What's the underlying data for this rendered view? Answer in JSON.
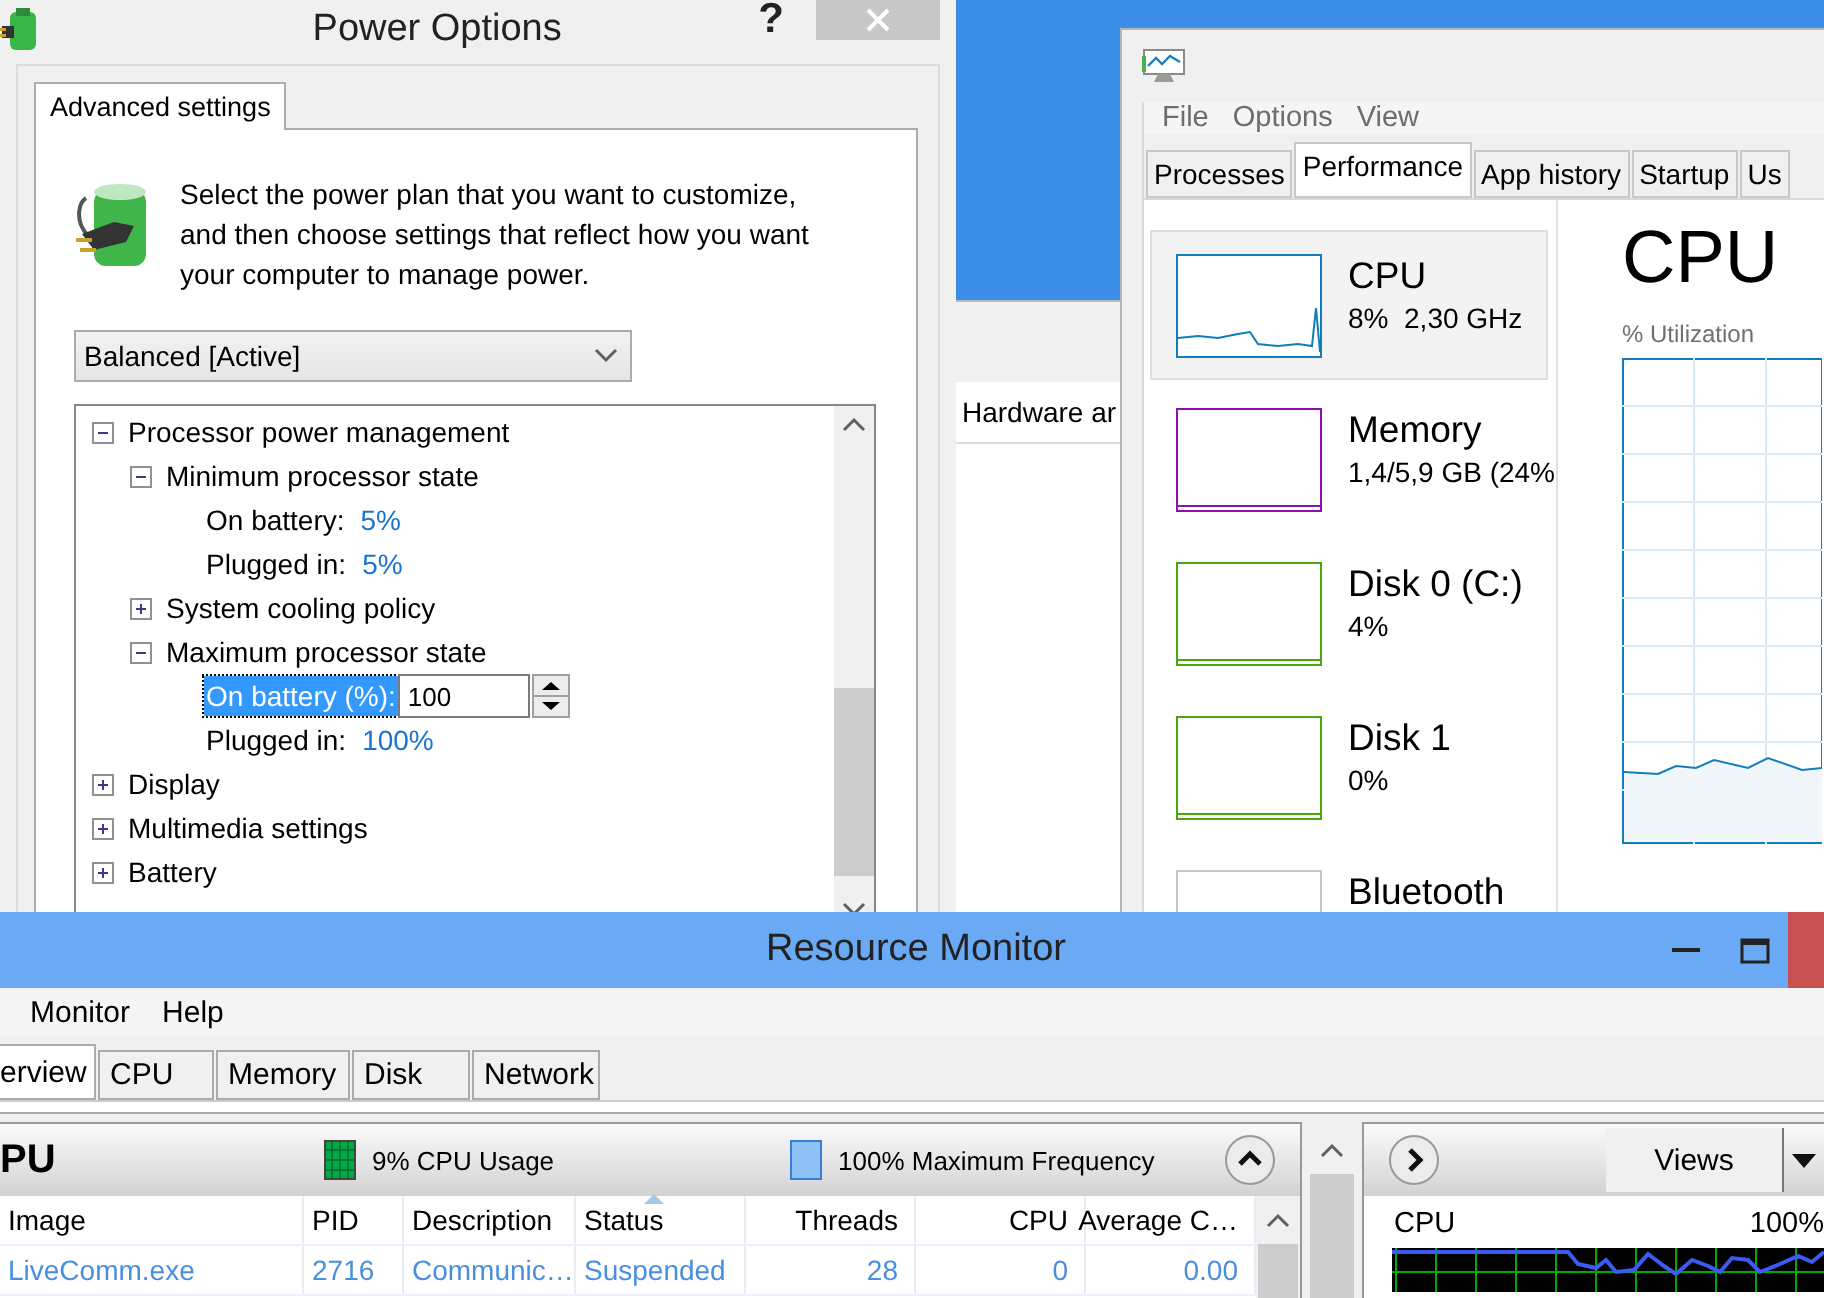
{
  "power_options": {
    "title": "Power Options",
    "help": "?",
    "tab": "Advanced settings",
    "description": "Select the power plan that you want to customize, and then choose settings that reflect how you want your computer to manage power.",
    "plan": "Balanced [Active]",
    "tree": [
      {
        "kind": "group",
        "label": "Processor power management",
        "expanded": true,
        "children": [
          {
            "kind": "group",
            "label": "Minimum processor state",
            "expanded": true,
            "children": [
              {
                "kind": "setting",
                "label": "On battery:",
                "value": "5%",
                "selected": false
              },
              {
                "kind": "setting",
                "label": "Plugged in:",
                "value": "5%",
                "selected": false
              }
            ]
          },
          {
            "kind": "group",
            "label": "System cooling policy",
            "expanded": false
          },
          {
            "kind": "group",
            "label": "Maximum processor state",
            "expanded": true,
            "children": [
              {
                "kind": "edit",
                "label": "On battery (%):",
                "value": "100",
                "selected": true
              },
              {
                "kind": "setting",
                "label": "Plugged in:",
                "value": "100%",
                "selected": false
              }
            ]
          }
        ]
      },
      {
        "kind": "group",
        "label": "Display",
        "expanded": false
      },
      {
        "kind": "group",
        "label": "Multimedia settings",
        "expanded": false
      },
      {
        "kind": "group",
        "label": "Battery",
        "expanded": false
      }
    ]
  },
  "background_window": {
    "row": "Hardware ar"
  },
  "task_manager": {
    "menu": [
      "File",
      "Options",
      "View"
    ],
    "tabs": [
      {
        "label": "Processes",
        "selected": false
      },
      {
        "label": "Performance",
        "selected": true
      },
      {
        "label": "App history",
        "selected": false
      },
      {
        "label": "Startup",
        "selected": false
      },
      {
        "label": "Us",
        "selected": false
      }
    ],
    "resources": [
      {
        "name": "CPU",
        "reading": "8%  2,30 GHz",
        "selected": true,
        "color": "#117dbb"
      },
      {
        "name": "Memory",
        "reading": "1,4/5,9 GB (24%",
        "selected": false,
        "color": "#8b12ae"
      },
      {
        "name": "Disk 0 (C:)",
        "reading": "4%",
        "selected": false,
        "color": "#4da60c"
      },
      {
        "name": "Disk 1",
        "reading": "0%",
        "selected": false,
        "color": "#4da60c"
      },
      {
        "name": "Bluetooth",
        "selected": false,
        "color": "#c6c6c6"
      }
    ],
    "detail": {
      "title": "CPU",
      "subtitle": "% Utilization"
    }
  },
  "resource_monitor": {
    "title": "Resource Monitor",
    "menu": [
      "Monitor",
      "Help"
    ],
    "tabs": [
      {
        "label": "erview",
        "selected": true
      },
      {
        "label": "CPU",
        "selected": false
      },
      {
        "label": "Memory",
        "selected": false
      },
      {
        "label": "Disk",
        "selected": false
      },
      {
        "label": "Network",
        "selected": false
      }
    ],
    "cpu_panel": {
      "title": "PU",
      "usage": "9% CPU Usage",
      "frequency": "100% Maximum Frequency",
      "columns": [
        {
          "label": "Image",
          "sorted": false
        },
        {
          "label": "PID",
          "sorted": false
        },
        {
          "label": "Description",
          "sorted": false
        },
        {
          "label": "Status",
          "sorted": true
        },
        {
          "label": "Threads",
          "sorted": false
        },
        {
          "label": "CPU",
          "sorted": false
        },
        {
          "label": "Average C…",
          "sorted": false
        }
      ],
      "rows": [
        [
          "LiveComm.exe",
          "2716",
          "Communic…",
          "Suspended",
          "28",
          "0",
          "0.00"
        ]
      ]
    },
    "side_panel": {
      "button": "Views",
      "graph_label": "CPU",
      "graph_reading": "100%"
    }
  }
}
